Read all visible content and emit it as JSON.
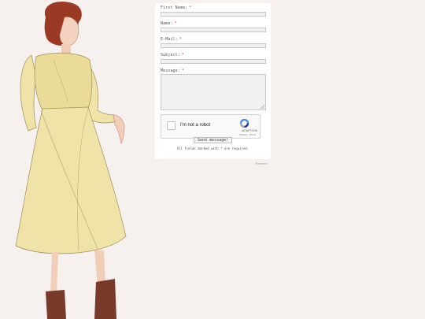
{
  "form": {
    "fields": [
      {
        "label": "First Name:",
        "required_mark": "*"
      },
      {
        "label": "Name:",
        "required_mark": "*"
      },
      {
        "label": "E-Mail:",
        "required_mark": "*"
      },
      {
        "label": "Subject:",
        "required_mark": "*"
      },
      {
        "label": "Message:",
        "required_mark": "*"
      }
    ],
    "captcha": {
      "label": "I'm not a robot",
      "brand": "reCAPTCHA",
      "links": "Privacy - Terms"
    },
    "submit_label": "Send message!",
    "required_note": "All fields marked with * are required."
  },
  "footer": {
    "powered_by": "Powered"
  },
  "colors": {
    "page_background": "#f6f0ef",
    "panel_background": "#ffffff",
    "required_mark": "#d23b3b",
    "dress": "#efe3a8",
    "boots": "#7a3a2b",
    "hair": "#9b3a24"
  },
  "icons": [
    "fashion-illustration",
    "recaptcha-logo-icon",
    "resize-grip-icon"
  ]
}
